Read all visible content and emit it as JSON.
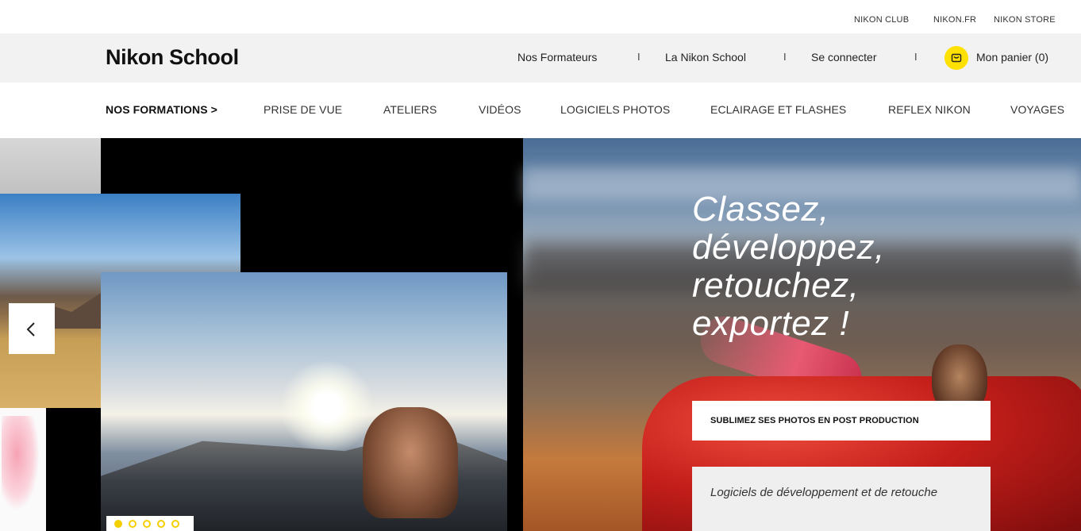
{
  "utility_links": [
    "NIKON CLUB",
    "NIKON.FR",
    "NIKON STORE"
  ],
  "header": {
    "logo": "Nikon School",
    "links": [
      "Nos Formateurs",
      "La Nikon School",
      "Se connecter"
    ],
    "separator": "I",
    "cart_label": "Mon panier (0)",
    "cart_icon": "basket-icon"
  },
  "main_nav": {
    "items": [
      "NOS FORMATIONS >",
      "PRISE DE VUE",
      "ATELIERS",
      "VIDÉOS",
      "LOGICIELS PHOTOS",
      "ECLAIRAGE ET FLASHES",
      "REFLEX NIKON",
      "VOYAGES"
    ]
  },
  "hero": {
    "headline": [
      "Classez,",
      "développez,",
      "retouchez,",
      "exportez !"
    ],
    "cta_label": "SUBLIMEZ SES PHOTOS EN POST PRODUCTION",
    "caption": "Logiciels de développement et de retouche",
    "slide_count": 5,
    "active_slide": 1,
    "accent_color": "#f5d000"
  }
}
